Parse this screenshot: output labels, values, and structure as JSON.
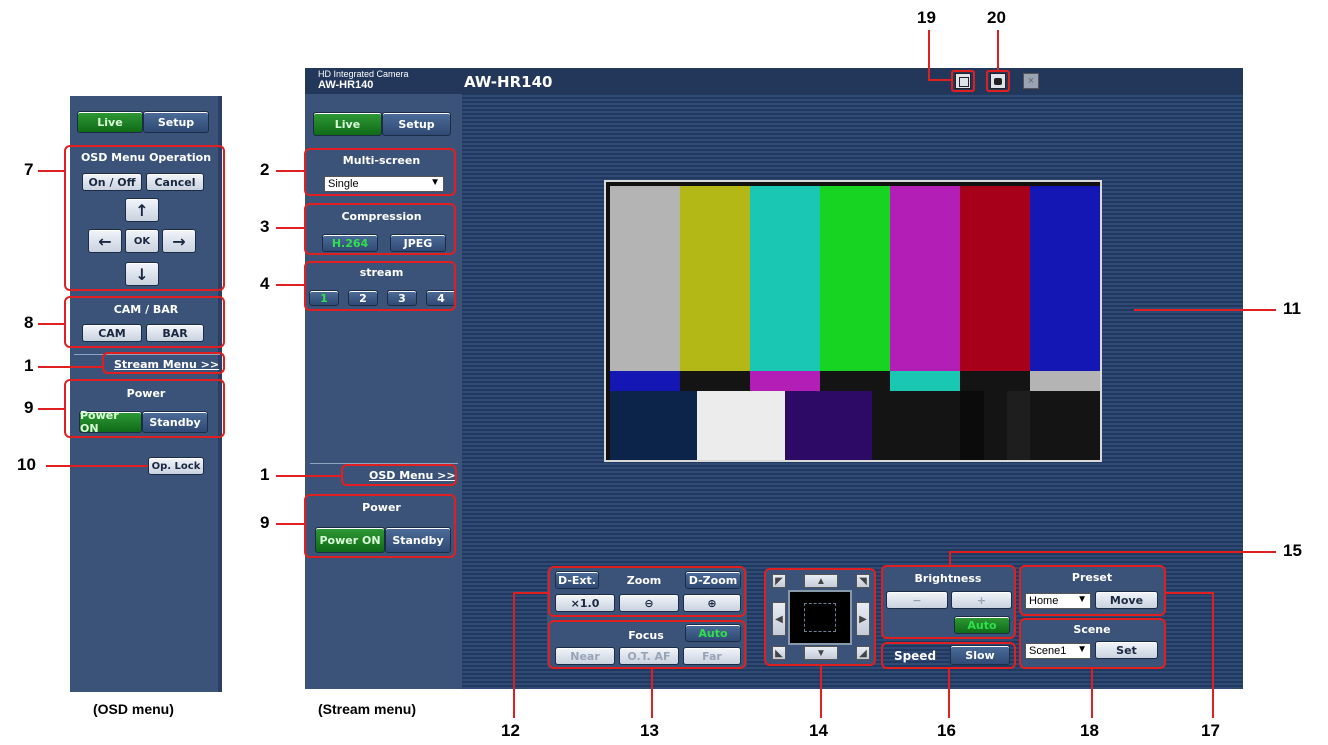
{
  "osd": {
    "live": "Live",
    "setup": "Setup",
    "osd_title": "OSD Menu Operation",
    "on_off": "On / Off",
    "cancel": "Cancel",
    "up": "↑",
    "left": "←",
    "ok": "OK",
    "right": "→",
    "down": "↓",
    "cambar_title": "CAM / BAR",
    "cam": "CAM",
    "bar": "BAR",
    "stream_menu_link": "Stream Menu >>",
    "power_title": "Power",
    "power_on": "Power ON",
    "standby": "Standby",
    "op_lock": "Op. Lock",
    "caption": "(OSD menu)"
  },
  "stream": {
    "hd_label": "HD Integrated Camera",
    "model_small": "AW-HR140",
    "model_title": "AW-HR140",
    "live": "Live",
    "setup": "Setup",
    "multiscreen_title": "Multi-screen",
    "multiscreen_value": "Single",
    "compression_title": "Compression",
    "h264": "H.264",
    "jpeg": "JPEG",
    "stream_title": "stream",
    "streams": [
      "1",
      "2",
      "3",
      "4"
    ],
    "osd_menu_link": "OSD Menu >>",
    "power_title": "Power",
    "power_on": "Power ON",
    "standby": "Standby",
    "caption": "(Stream menu)"
  },
  "controls": {
    "dext": "D-Ext.",
    "zoom": "Zoom",
    "dzoom": "D-Zoom",
    "x10": "×1.0",
    "focus": "Focus",
    "auto": "Auto",
    "near": "Near",
    "otaf": "O.T. AF",
    "far": "Far",
    "brightness": "Brightness",
    "minus": "−",
    "plus": "+",
    "bright_auto": "Auto",
    "speed": "Speed",
    "slow": "Slow",
    "preset": "Preset",
    "preset_value": "Home",
    "move": "Move",
    "scene": "Scene",
    "scene_value": "Scene1",
    "set": "Set"
  },
  "callouts": {
    "n1a": "1",
    "n1b": "1",
    "n2": "2",
    "n3": "3",
    "n4": "4",
    "n7": "7",
    "n8": "8",
    "n9a": "9",
    "n9b": "9",
    "n10": "10",
    "n11": "11",
    "n12": "12",
    "n13": "13",
    "n14": "14",
    "n15": "15",
    "n16": "16",
    "n17": "17",
    "n18": "18",
    "n19": "19",
    "n20": "20"
  },
  "colors": {
    "accent_green": "#0f6a17",
    "panel_blue": "#3b5378",
    "callout_red": "#e02020"
  }
}
